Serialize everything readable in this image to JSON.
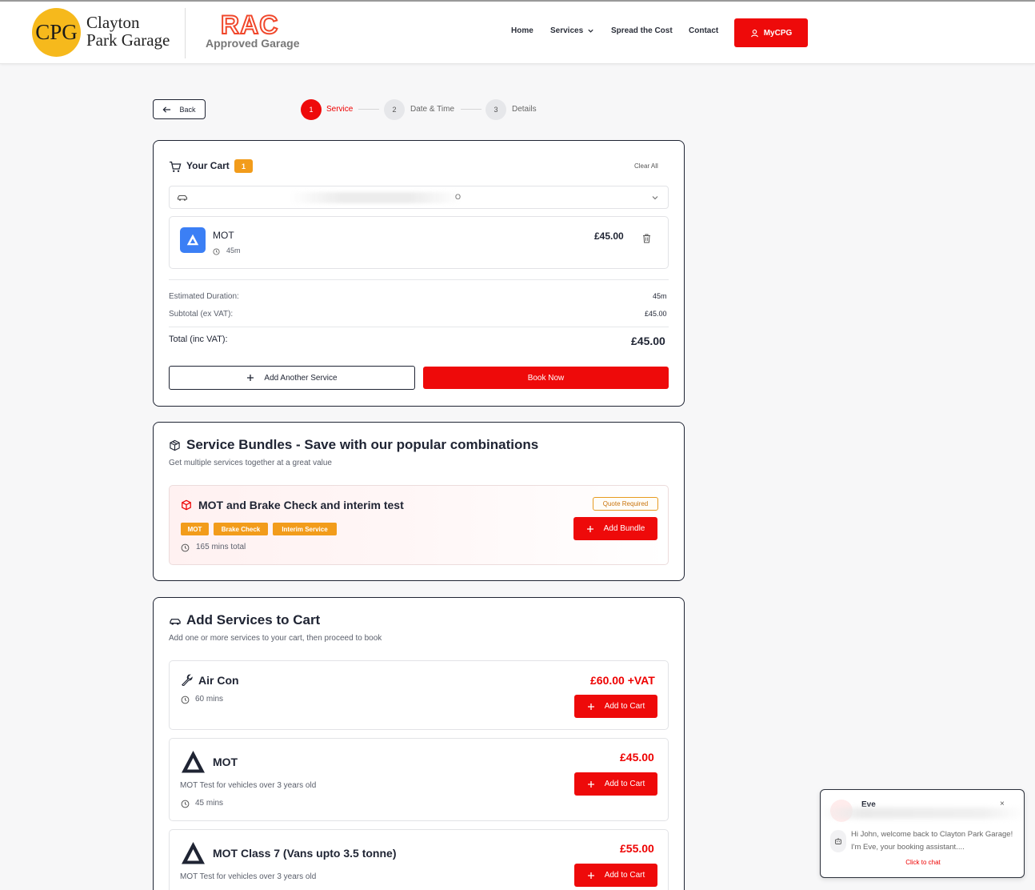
{
  "header": {
    "logo_initials": "CPG",
    "logo_line1": "Clayton",
    "logo_line2": "Park Garage",
    "partner_mark": "RAC",
    "partner_sub": "Approved Garage",
    "nav": [
      "Home",
      "Services",
      "Spread the Cost",
      "Contact"
    ],
    "account_button": "MyCPG"
  },
  "stepper": {
    "back_label": "Back",
    "steps": [
      {
        "num": "1",
        "label": "Service",
        "active": true
      },
      {
        "num": "2",
        "label": "Date & Time",
        "active": false
      },
      {
        "num": "3",
        "label": "Details",
        "active": false
      }
    ]
  },
  "cart": {
    "title": "Your Cart",
    "count": "1",
    "clear_label": "Clear All",
    "vehicle_suffix": "O",
    "item": {
      "name": "MOT",
      "duration": "45m",
      "price": "£45.00"
    },
    "estimated_duration_label": "Estimated Duration:",
    "estimated_duration_value": "45m",
    "subtotal_label": "Subtotal (ex VAT):",
    "subtotal_value": "£45.00",
    "total_label": "Total (inc VAT):",
    "total_value": "£45.00",
    "add_another_label": "Add Another Service",
    "book_now_label": "Book Now"
  },
  "bundles": {
    "title": "Service Bundles - Save with our popular combinations",
    "subtitle": "Get multiple services together at a great value",
    "bundle": {
      "name": "MOT and Brake Check and interim test",
      "tags": [
        "MOT",
        "Brake Check",
        "Interim Service"
      ],
      "duration": "165 mins total",
      "quote_label": "Quote Required",
      "add_label": "Add Bundle"
    }
  },
  "services": {
    "title": "Add Services to Cart",
    "subtitle": "Add one or more services to your cart, then proceed to book",
    "add_label": "Add to Cart",
    "items": [
      {
        "name": "Air Con",
        "description": "",
        "duration": "60 mins",
        "price": "£60.00 +VAT",
        "icon": "wrench-icon"
      },
      {
        "name": "MOT",
        "description": "MOT Test for vehicles over 3 years old",
        "duration": "45 mins",
        "price": "£45.00",
        "icon": "mot-triangle-icon"
      },
      {
        "name": "MOT Class 7 (Vans upto 3.5 tonne)",
        "description": "MOT Test for vehicles over 3 years old",
        "duration": "",
        "price": "£55.00",
        "icon": "mot-triangle-icon"
      }
    ]
  },
  "chat": {
    "name": "Eve",
    "message": "Hi John, welcome back to Clayton Park Garage! I'm Eve, your booking assistant....",
    "cta": "Click to chat"
  },
  "colors": {
    "accent": "#ee0a0a",
    "badge": "#f29c1b",
    "logo_yellow": "#f6b91c",
    "mot_blue": "#3b7ff5"
  }
}
